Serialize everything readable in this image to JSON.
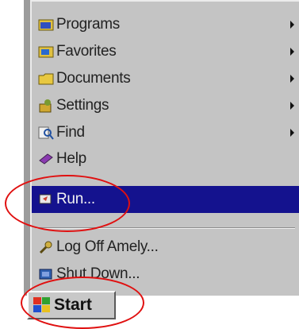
{
  "menu": {
    "items": [
      {
        "label": "Programs",
        "icon": "programs-folder-icon",
        "submenu": true,
        "highlighted": false
      },
      {
        "label": "Favorites",
        "icon": "favorites-folder-icon",
        "submenu": true,
        "highlighted": false
      },
      {
        "label": "Documents",
        "icon": "documents-folder-icon",
        "submenu": true,
        "highlighted": false
      },
      {
        "label": "Settings",
        "icon": "settings-icon",
        "submenu": true,
        "highlighted": false
      },
      {
        "label": "Find",
        "icon": "find-magnifier-icon",
        "submenu": true,
        "highlighted": false
      },
      {
        "label": "Help",
        "icon": "help-book-icon",
        "submenu": false,
        "highlighted": false
      },
      {
        "label": "Run...",
        "icon": "run-icon",
        "submenu": false,
        "highlighted": true
      },
      {
        "label": "Log Off Amely...",
        "icon": "log-off-key-icon",
        "submenu": false,
        "highlighted": false
      },
      {
        "label": "Shut Down...",
        "icon": "shut-down-icon",
        "submenu": false,
        "highlighted": false
      }
    ]
  },
  "taskbar": {
    "start_label": "Start"
  },
  "colors": {
    "menu_bg": "#c4c4c4",
    "highlight": "#14128e",
    "annotation": "#e01010"
  }
}
